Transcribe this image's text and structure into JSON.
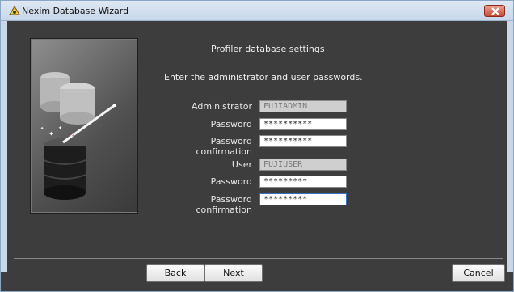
{
  "window": {
    "title": "Nexim Database Wizard"
  },
  "page": {
    "heading": "Profiler database settings",
    "instructions": "Enter the administrator and user passwords."
  },
  "admin": {
    "label": "Administrator",
    "name": "FUJIADMIN",
    "password_label": "Password",
    "password_value": "**********",
    "confirm_label": "Password confirmation",
    "confirm_value": "**********"
  },
  "user": {
    "label": "User",
    "name": "FUJIUSER",
    "password_label": "Password",
    "password_value": "*********",
    "confirm_label": "Password confirmation",
    "confirm_value": "*********"
  },
  "buttons": {
    "back": "Back",
    "next": "Next",
    "cancel": "Cancel"
  },
  "colors": {
    "background": "#3d3d3d",
    "titlebar": "#c7d7ea",
    "close": "#c64a34"
  },
  "icons": {
    "app": "wizard-icon",
    "close": "close-icon",
    "illustration": "database-wand-illustration"
  }
}
